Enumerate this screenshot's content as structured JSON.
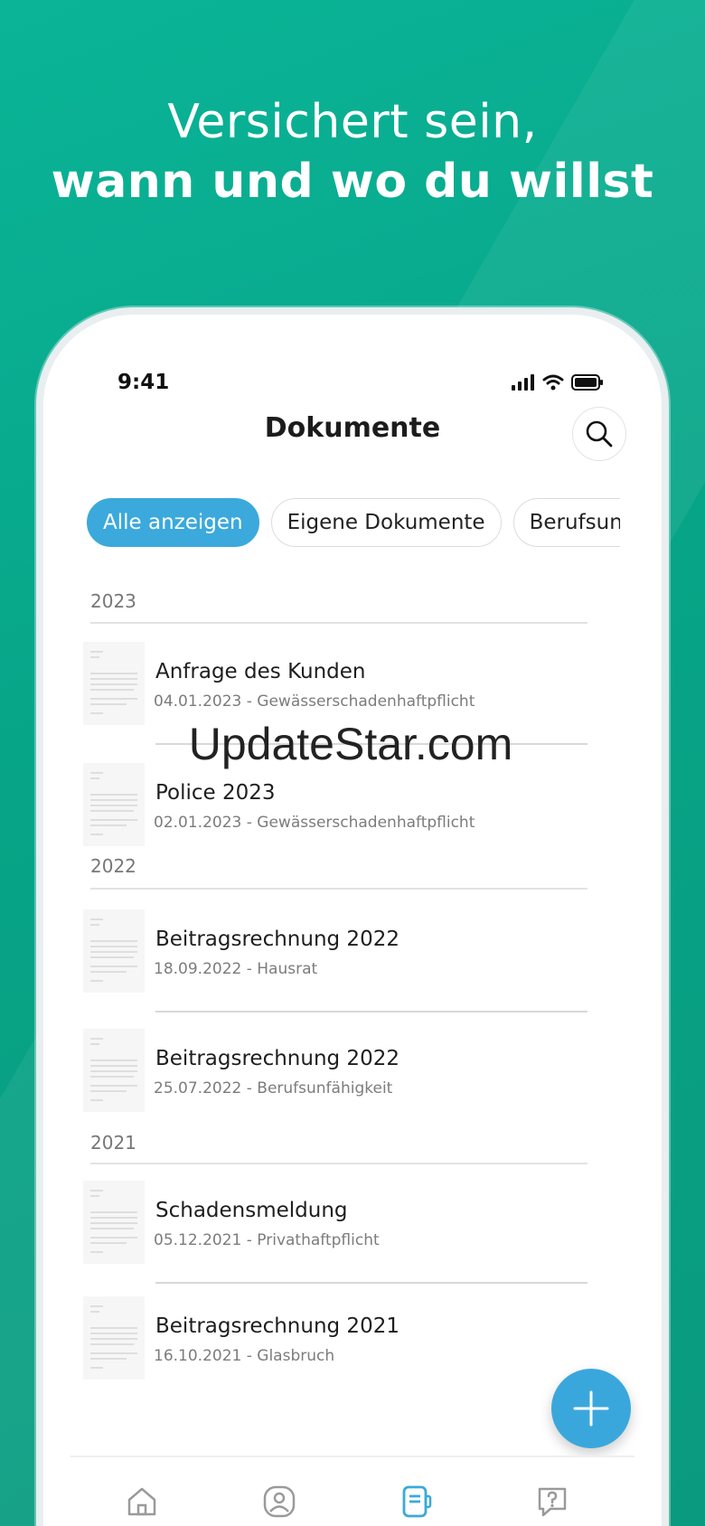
{
  "headline": {
    "line1": "Versichert sein,",
    "line2": "wann und wo du willst"
  },
  "status_bar": {
    "time": "9:41"
  },
  "header": {
    "title": "Dokumente"
  },
  "filters": [
    {
      "label": "Alle anzeigen",
      "active": true
    },
    {
      "label": "Eigene Dokumente",
      "active": false
    },
    {
      "label": "Berufsunfähigkeit",
      "active": false
    }
  ],
  "sections": [
    {
      "year": "2023",
      "documents": [
        {
          "title": "Anfrage des Kunden",
          "subtitle": "04.01.2023 - Gewässerschadenhaftpflicht"
        },
        {
          "title": "Police 2023",
          "subtitle": "02.01.2023 - Gewässerschadenhaftpflicht"
        }
      ]
    },
    {
      "year": "2022",
      "documents": [
        {
          "title": "Beitragsrechnung 2022",
          "subtitle": "18.09.2022 - Hausrat"
        },
        {
          "title": "Beitragsrechnung 2022",
          "subtitle": "25.07.2022 - Berufsunfähigkeit"
        }
      ]
    },
    {
      "year": "2021",
      "documents": [
        {
          "title": "Schadensmeldung",
          "subtitle": "05.12.2021 - Privathaftpflicht"
        },
        {
          "title": "Beitragsrechnung 2021",
          "subtitle": "16.10.2021 - Glasbruch"
        }
      ]
    }
  ],
  "watermark": "UpdateStar.com",
  "tabbar": [
    {
      "icon": "home-icon",
      "active": false
    },
    {
      "icon": "profile-icon",
      "active": false
    },
    {
      "icon": "documents-icon",
      "active": true
    },
    {
      "icon": "help-icon",
      "active": false
    }
  ],
  "colors": {
    "background": "#07a487",
    "accent": "#3ba9db",
    "text": "#1e1e1e",
    "muted": "#7c7c7c"
  }
}
